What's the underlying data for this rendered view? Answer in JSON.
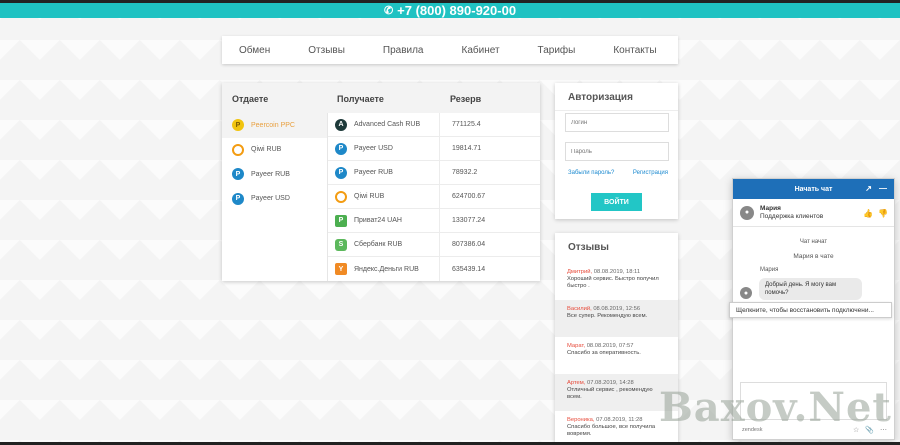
{
  "topbar": {
    "phone": "+7 (800) 890-920-00"
  },
  "nav": {
    "items": [
      "Обмен",
      "Отзывы",
      "Правила",
      "Кабинет",
      "Тарифы",
      "Контакты"
    ]
  },
  "exchange": {
    "headers": {
      "give": "Отдаете",
      "get": "Получаете",
      "reserve": "Резерв"
    },
    "give": [
      {
        "label": "Peercoin PPC",
        "icon": "pp",
        "active": true
      },
      {
        "label": "Qiwi RUB",
        "icon": "qiwi"
      },
      {
        "label": "Payeer RUB",
        "icon": "payeer"
      },
      {
        "label": "Payeer USD",
        "icon": "payeer"
      }
    ],
    "get": [
      {
        "label": "Advanced Cash RUB",
        "icon": "acash",
        "reserve": "771125.4"
      },
      {
        "label": "Payeer USD",
        "icon": "payeer",
        "reserve": "19814.71"
      },
      {
        "label": "Payeer RUB",
        "icon": "payeer",
        "reserve": "78932.2"
      },
      {
        "label": "Qiwi RUB",
        "icon": "qiwi",
        "reserve": "624700.67"
      },
      {
        "label": "Приват24 UAH",
        "icon": "privat",
        "reserve": "133077.24"
      },
      {
        "label": "Сбербанк RUB",
        "icon": "sber",
        "reserve": "807386.04"
      },
      {
        "label": "Яндекс.Деньги RUB",
        "icon": "yandex",
        "reserve": "635439.14"
      }
    ]
  },
  "auth": {
    "title": "Авторизация",
    "login_placeholder": "Логин",
    "password_placeholder": "Пароль",
    "forgot": "Забыли пароль?",
    "register": "Регистрация",
    "submit": "ВОЙТИ"
  },
  "reviews": {
    "title": "Отзывы",
    "items": [
      {
        "author": "Дмитрий,",
        "date": "08.08.2019, 18:11",
        "text": "Хороший сервис. Быстро получил быстро ."
      },
      {
        "author": "Василий,",
        "date": "08.08.2019, 12:56",
        "text": "Все супер. Рекомендую всем."
      },
      {
        "author": "Марат,",
        "date": "08.08.2019, 07:57",
        "text": "Спасибо за оперативность."
      },
      {
        "author": "Артем,",
        "date": "07.08.2019, 14:28",
        "text": "Отличный сервис , рекомендую всем."
      },
      {
        "author": "Вероника,",
        "date": "07.08.2019, 11:28",
        "text": "Спасибо большое, все получила вовремя."
      }
    ]
  },
  "chat": {
    "header": "Начать чат",
    "agent_name": "Мария",
    "agent_role": "Поддержка клиентов",
    "started": "Чат начат",
    "joined": "Мария в чате",
    "sender": "Мария",
    "message": "Добрый день. Я могу вам помочь?",
    "restore": "Щелкните, чтобы восстановить подключени...",
    "brand": "zendesk"
  },
  "watermark": "Baxov.Net"
}
